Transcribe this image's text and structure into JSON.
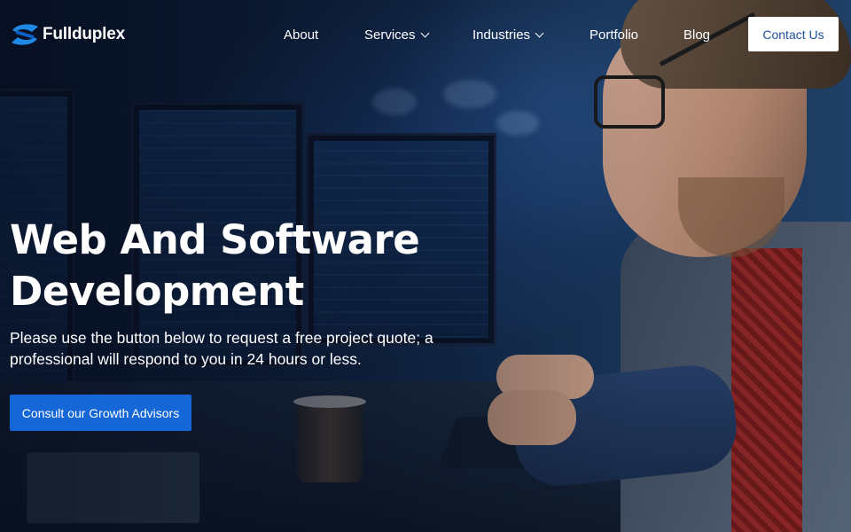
{
  "brand": {
    "name": "Fullduplex",
    "logo_icon": "swoosh-s-logo-icon",
    "accent": "#1e88e5"
  },
  "nav": {
    "items": [
      {
        "label": "About",
        "has_dropdown": false
      },
      {
        "label": "Services",
        "has_dropdown": true
      },
      {
        "label": "Industries",
        "has_dropdown": true
      },
      {
        "label": "Portfolio",
        "has_dropdown": false
      },
      {
        "label": "Blog",
        "has_dropdown": false
      }
    ],
    "contact_label": "Contact Us"
  },
  "hero": {
    "title_line1": "Web And Software",
    "title_line2": "Development",
    "subtitle": "Please use the button below to request a free project quote; a professional will respond to you in 24 hours or less.",
    "cta_label": "Consult our Growth Advisors"
  },
  "colors": {
    "cta": "#1566d6",
    "contact_text": "#1d4f9e",
    "text": "#ffffff"
  }
}
